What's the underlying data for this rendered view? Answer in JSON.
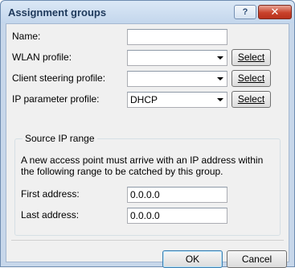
{
  "window": {
    "title": "Assignment groups",
    "help_label": "?",
    "close_label": "✕"
  },
  "form": {
    "name_label": "Name:",
    "name_value": "",
    "wlan_label": "WLAN profile:",
    "wlan_value": "",
    "steering_label": "Client steering profile:",
    "steering_value": "",
    "ip_label": "IP parameter profile:",
    "ip_value": "DHCP",
    "select_label": "Select"
  },
  "source_ip": {
    "group_title": "Source IP range",
    "description": "A new access point must arrive with an IP address within the following range to be catched by this group.",
    "first_label": "First address:",
    "first_value": "0.0.0.0",
    "last_label": "Last address:",
    "last_value": "0.0.0.0"
  },
  "buttons": {
    "ok": "OK",
    "cancel": "Cancel"
  }
}
